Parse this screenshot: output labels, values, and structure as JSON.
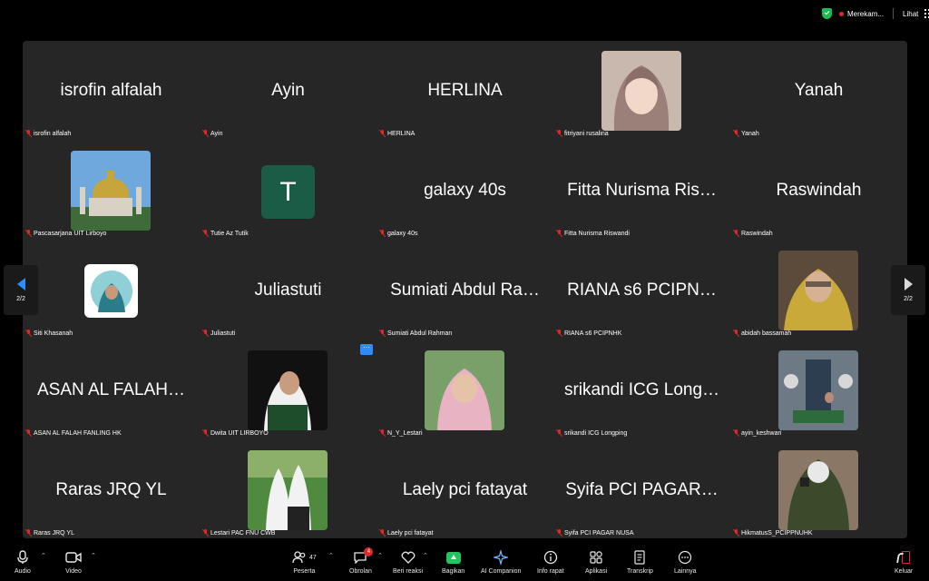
{
  "topbar": {
    "recording_label": "Merekam...",
    "view_label": "Lihat"
  },
  "pager": {
    "left_label": "2/2",
    "right_label": "2/2"
  },
  "more_menu": "···",
  "participants": [
    {
      "name": "isrofin alfalah",
      "label": "isrofin alfalah",
      "display": "text"
    },
    {
      "name": "Ayin",
      "label": "Ayin",
      "display": "text"
    },
    {
      "name": "HERLINA",
      "label": "HERLINA",
      "display": "text"
    },
    {
      "name": "",
      "label": "fitriyani rusalina",
      "display": "photo"
    },
    {
      "name": "Yanah",
      "label": "Yanah",
      "display": "text"
    },
    {
      "name": "",
      "label": "Pascasarjana UIT Lirboyo",
      "display": "photo"
    },
    {
      "name": "T",
      "label": "Tutie Az Tutik",
      "display": "letter"
    },
    {
      "name": "galaxy 40s",
      "label": "galaxy 40s",
      "display": "text"
    },
    {
      "name": "Fitta Nurisma Ris…",
      "label": "Fitta Nurisma Riswandi",
      "display": "text"
    },
    {
      "name": "Raswindah",
      "label": "Raswindah",
      "display": "text"
    },
    {
      "name": "",
      "label": "Siti Khasanah",
      "display": "round"
    },
    {
      "name": "Juliastuti",
      "label": "Juliastuti",
      "display": "text"
    },
    {
      "name": "Sumiati Abdul Ra…",
      "label": "Sumiati Abdul Rahman",
      "display": "text"
    },
    {
      "name": "RIANA s6 PCIPN…",
      "label": "RIANA s6 PCIPNHK",
      "display": "text"
    },
    {
      "name": "",
      "label": "abidah bassamah",
      "display": "photo"
    },
    {
      "name": "ASAN AL FALAH…",
      "label": "ASAN AL FALAH  FANLING  HK",
      "display": "text"
    },
    {
      "name": "",
      "label": "Dwita UIT LIRBOYO",
      "display": "photo"
    },
    {
      "name": "",
      "label": "N_Y_Lestari",
      "display": "photo"
    },
    {
      "name": "srikandi ICG Long…",
      "label": "srikandi ICG Longping",
      "display": "text"
    },
    {
      "name": "",
      "label": "ayin_keshwari",
      "display": "photo"
    },
    {
      "name": "Raras JRQ YL",
      "label": "Raras JRQ YL",
      "display": "text"
    },
    {
      "name": "",
      "label": "Lestari PAC FNU CWB",
      "display": "photo"
    },
    {
      "name": "Laely pci fatayat",
      "label": "Laely pci fatayat",
      "display": "text"
    },
    {
      "name": "Syifa PCI PAGAR…",
      "label": "Syifa PCI PAGAR NUSA",
      "display": "text"
    },
    {
      "name": "",
      "label": "HikmatusS_PCIPPNUHK",
      "display": "photo"
    }
  ],
  "toolbar": {
    "audio": "Audio",
    "video": "Video",
    "participants": "Peserta",
    "participants_count": "47",
    "chat": "Obrolan",
    "chat_badge": "4",
    "reactions": "Beri reaksi",
    "share": "Bagikan",
    "ai": "AI Companion",
    "info": "Info rapat",
    "apps": "Aplikasi",
    "transcript": "Transkrip",
    "more": "Lainnya",
    "leave": "Keluar"
  },
  "colors": {
    "accent": "#2d8cff",
    "share": "#23c55e",
    "muted": "#e02828",
    "tile_bg": "#262626",
    "letter_avatar": "#1a5c45"
  }
}
